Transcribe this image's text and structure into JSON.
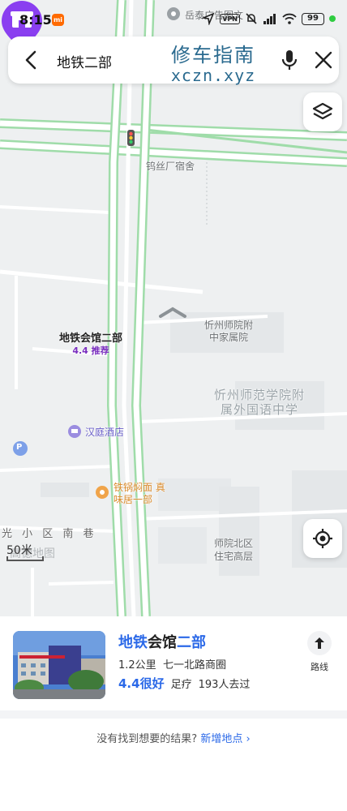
{
  "status_bar": {
    "time": "8:15",
    "app_badge": "mi",
    "vpn": "VPN",
    "battery": "99"
  },
  "search": {
    "query": "地铁二部"
  },
  "watermark": {
    "line1": "修车指南",
    "line2": "xczn.xyz"
  },
  "map": {
    "labels": {
      "top_poi": "岳泰广告图文",
      "dormitory": "钨丝厂宿舍",
      "school_annex_line1": "忻州师院附",
      "school_annex_line2": "中家属院",
      "school_big_line1": "忻州师范学院附",
      "school_big_line2": "属外国语中学",
      "hotel": "汉庭酒店",
      "noodle_line1": "铁锅焖面 真",
      "noodle_line2": "味居一部",
      "street": "光 小 区 南 巷",
      "residence_line1": "师院北区",
      "residence_line2": "住宅高层"
    },
    "poi": {
      "name": "地铁会馆二部",
      "rating": "4.4 推荐"
    },
    "scale": "50米",
    "brand": "高德地图",
    "parking": "P"
  },
  "result": {
    "title_part1": "地铁",
    "title_part2": "会馆",
    "title_part3": "二部",
    "distance": "1.2公里",
    "address": "七一北路商圈",
    "rating": "4.4很好",
    "category": "足疗",
    "visits": "193人去过",
    "route_label": "路线"
  },
  "footer": {
    "no_result_text": "没有找到想要的结果?",
    "add_place_link": "新增地点",
    "chevron": "›"
  },
  "colors": {
    "road_green": "#9fdca9",
    "accent_blue": "#2b69e8",
    "poi_purple": "#8a3ff0"
  }
}
